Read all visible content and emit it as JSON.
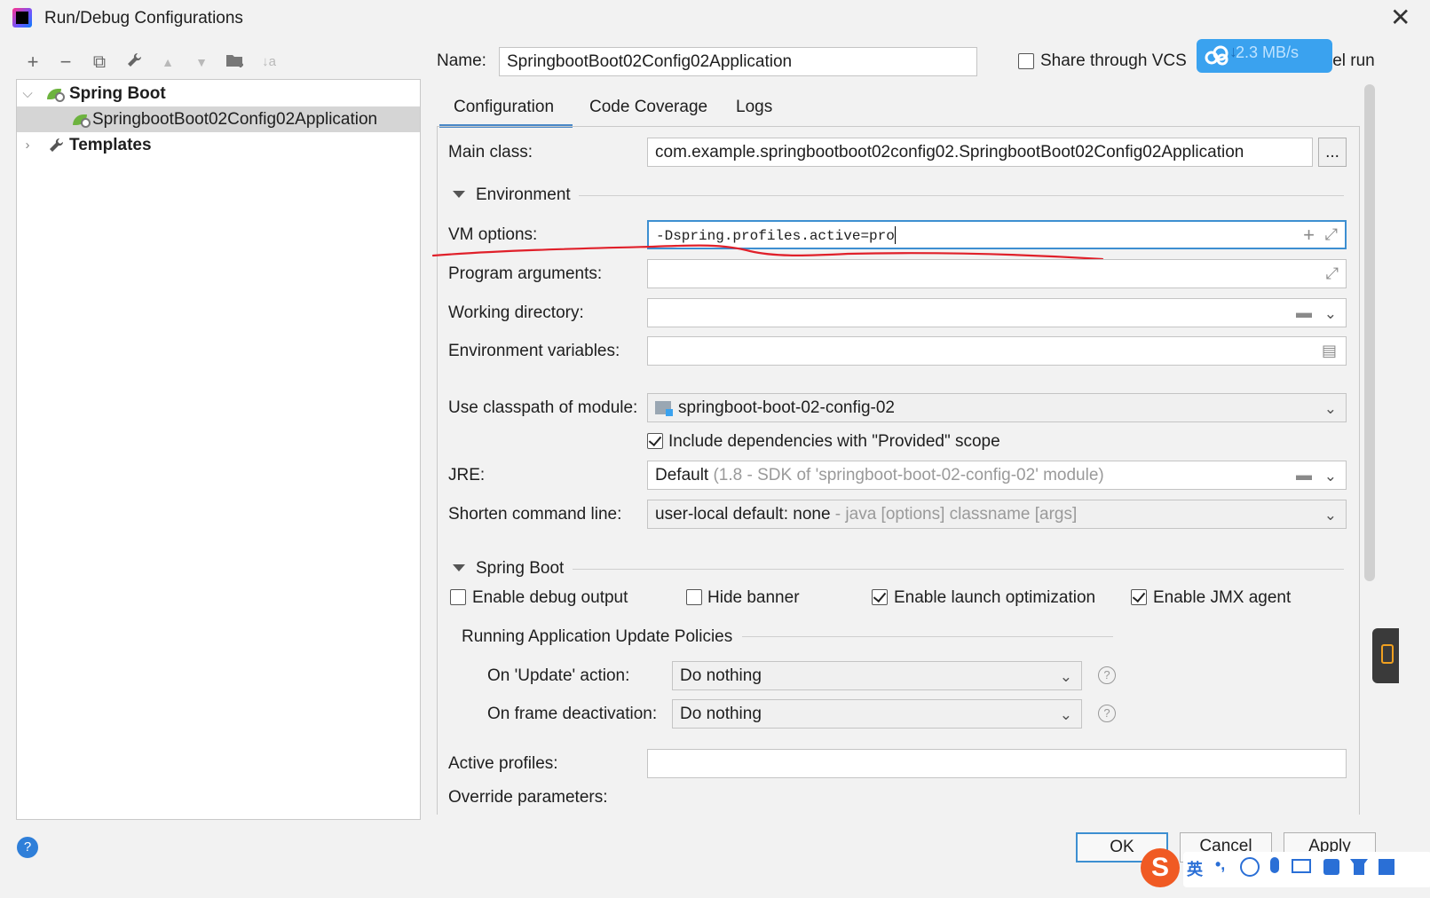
{
  "window": {
    "title": "Run/Debug Configurations",
    "close_glyph": "✕"
  },
  "toolbar": {
    "add": "+",
    "remove": "−",
    "copy": "⧉",
    "edit": "🔧",
    "up": "▲",
    "down": "▼",
    "folder": "📁",
    "sort": "↓a"
  },
  "tree": {
    "items": [
      {
        "label": "Spring Boot",
        "expanded": true
      },
      {
        "label": "SpringbootBoot02Config02Application",
        "selected": true
      },
      {
        "label": "Templates",
        "expanded": false
      }
    ]
  },
  "header": {
    "name_label": "Name:",
    "name_value": "SpringbootBoot02Config02Application",
    "share_label": "Share through VCS",
    "parallel_suffix": "lel run",
    "speed_badge": "2.3 MB/s"
  },
  "tabs": [
    "Configuration",
    "Code Coverage",
    "Logs"
  ],
  "config": {
    "main_class_label": "Main class:",
    "main_class_value": "com.example.springbootboot02config02.SpringbootBoot02Config02Application",
    "browse": "...",
    "environment_label": "Environment",
    "vm_options_label": "VM options:",
    "vm_options_value": "-Dspring.profiles.active=pro",
    "program_args_label": "Program arguments:",
    "working_dir_label": "Working directory:",
    "env_vars_label": "Environment variables:",
    "classpath_label": "Use classpath of module:",
    "classpath_value": "springboot-boot-02-config-02",
    "include_deps_label": "Include dependencies with \"Provided\" scope",
    "include_deps_checked": true,
    "jre_label": "JRE:",
    "jre_value": "Default",
    "jre_hint": "(1.8 - SDK of 'springboot-boot-02-config-02' module)",
    "shorten_label": "Shorten command line:",
    "shorten_value": "user-local default: none",
    "shorten_hint": "- java [options] classname [args]"
  },
  "spring_boot": {
    "section_label": "Spring Boot",
    "enable_debug": {
      "label": "Enable debug output",
      "checked": false
    },
    "hide_banner": {
      "label": "Hide banner",
      "checked": false
    },
    "launch_opt": {
      "label": "Enable launch optimization",
      "checked": true
    },
    "jmx_agent": {
      "label": "Enable JMX agent",
      "checked": true
    },
    "policies_label": "Running Application Update Policies",
    "on_update_label": "On 'Update' action:",
    "on_update_value": "Do nothing",
    "on_frame_label": "On frame deactivation:",
    "on_frame_value": "Do nothing",
    "help_glyph": "?",
    "active_profiles_label": "Active profiles:",
    "override_params_label": "Override parameters:"
  },
  "footer": {
    "ok": "OK",
    "cancel": "Cancel",
    "apply": "Apply",
    "help_glyph": "?"
  },
  "colors": {
    "accent": "#3d8fd1",
    "annotation": "#e0202a",
    "badge": "#3aa2ef",
    "sogou": "#f05a23"
  }
}
